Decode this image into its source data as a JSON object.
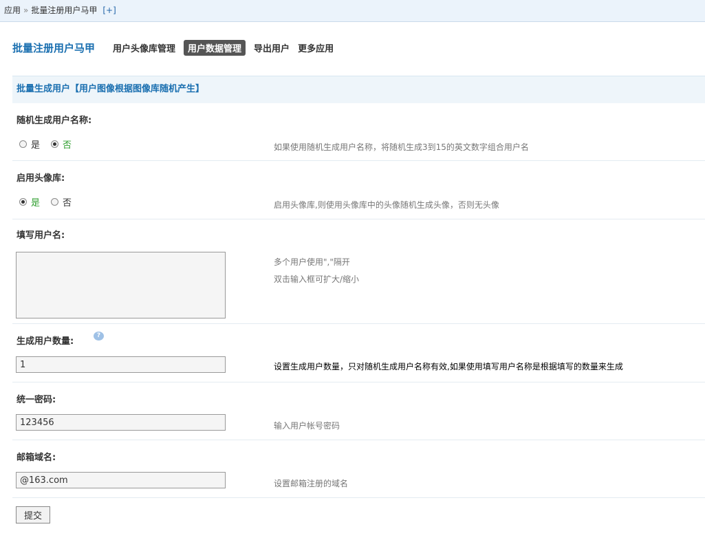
{
  "breadcrumb": {
    "root": "应用",
    "separator": "»",
    "current": "批量注册用户马甲",
    "add": "[+]"
  },
  "app_title": "批量注册用户马甲",
  "nav": [
    {
      "label": "用户头像库管理",
      "active": false
    },
    {
      "label": "用户数据管理",
      "active": true
    },
    {
      "label": "导出用户",
      "active": false
    },
    {
      "label": "更多应用",
      "active": false
    }
  ],
  "section_title": "批量生成用户【用户图像根据图像库随机产生】",
  "form": {
    "random_name": {
      "label": "随机生成用户名称:",
      "options": [
        "是",
        "否"
      ],
      "selected": "否",
      "tip": "如果使用随机生成用户名称，将随机生成3到15的英文数字组合用户名"
    },
    "avatar_lib": {
      "label": "启用头像库:",
      "options": [
        "是",
        "否"
      ],
      "selected": "是",
      "tip": "启用头像库,则使用头像库中的头像随机生成头像，否则无头像"
    },
    "usernames": {
      "label": "填写用户名:",
      "value": "",
      "tip_line1": "多个用户使用\",\"隔开",
      "tip_line2": "双击输入框可扩大/缩小"
    },
    "count": {
      "label": "生成用户数量:",
      "value": "1",
      "tip": "设置生成用户数量，只对随机生成用户名称有效,如果使用填写用户名称是根据填写的数量来生成"
    },
    "password": {
      "label": "统一密码:",
      "value": "123456",
      "tip": "输入用户帐号密码"
    },
    "email_domain": {
      "label": "邮箱域名:",
      "value": "@163.com",
      "tip": "设置邮箱注册的域名"
    },
    "submit_label": "提交"
  }
}
